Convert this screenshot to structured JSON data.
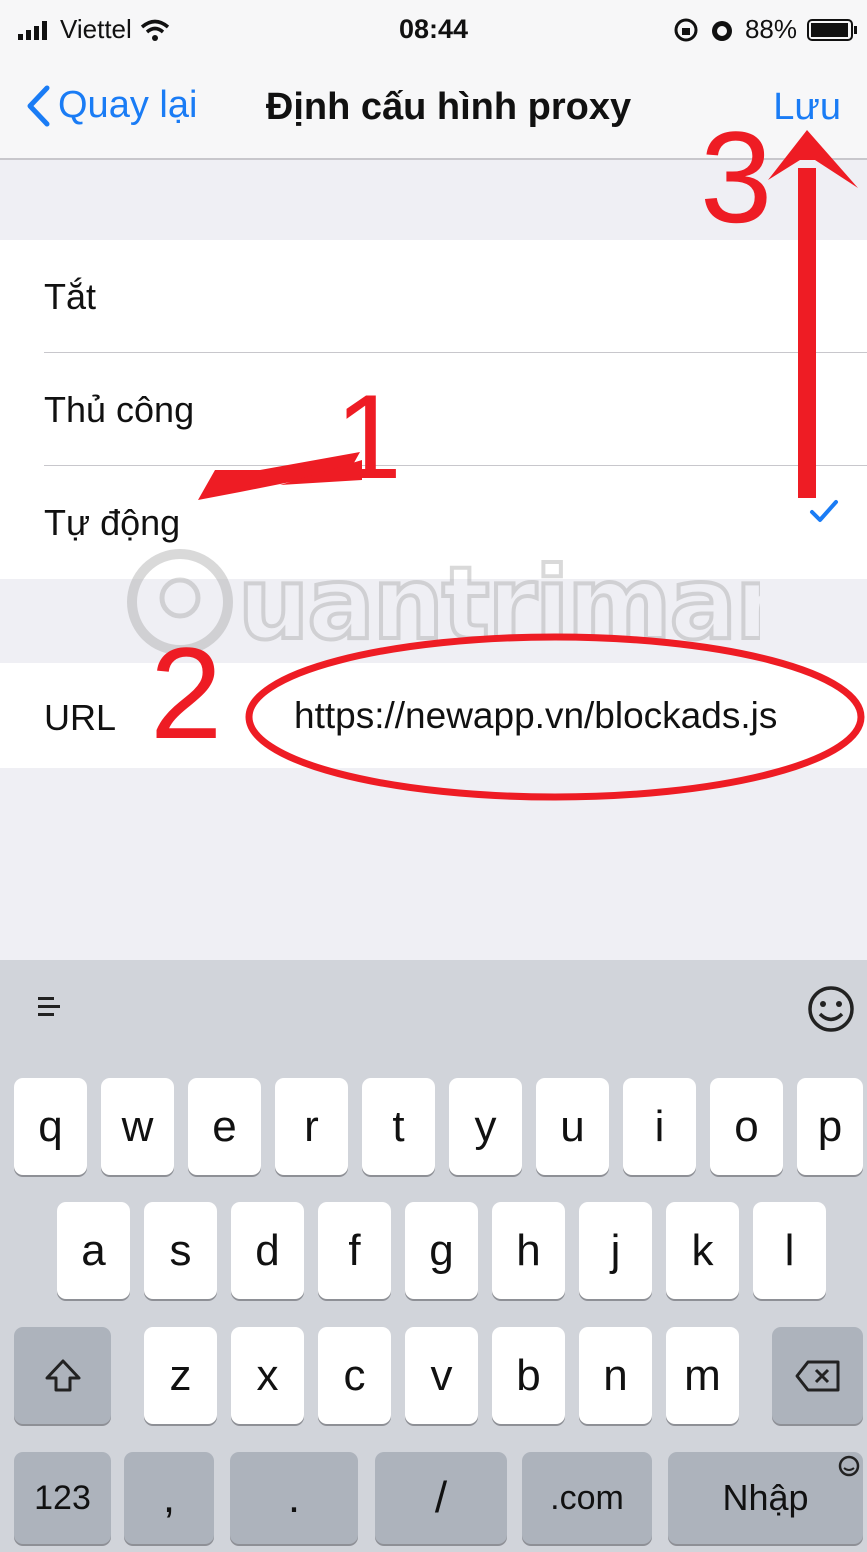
{
  "status": {
    "carrier": "Viettel",
    "time": "08:44",
    "battery": "88%"
  },
  "nav": {
    "back_label": "Quay lại",
    "title": "Định cấu hình proxy",
    "save_label": "Lưu"
  },
  "options": [
    {
      "label": "Tắt",
      "selected": false
    },
    {
      "label": "Thủ công",
      "selected": false
    },
    {
      "label": "Tự động",
      "selected": true
    }
  ],
  "url_field": {
    "label": "URL",
    "value": "https://newapp.vn/blockads.js"
  },
  "annotations": {
    "step1": "1",
    "step2": "2",
    "step3": "3",
    "color": "#ee1c24"
  },
  "watermark": "Quantrimang",
  "keyboard": {
    "row1": [
      "q",
      "w",
      "e",
      "r",
      "t",
      "y",
      "u",
      "i",
      "o",
      "p"
    ],
    "row2": [
      "a",
      "s",
      "d",
      "f",
      "g",
      "h",
      "j",
      "k",
      "l"
    ],
    "row3": [
      "z",
      "x",
      "c",
      "v",
      "b",
      "n",
      "m"
    ],
    "row4": {
      "numbers": "123",
      "comma": ",",
      "period": ".",
      "slash": "/",
      "dotcom": ".com",
      "enter": "Nhập"
    }
  },
  "colors": {
    "accent": "#1a7cf5",
    "annotation": "#ee1c24"
  }
}
